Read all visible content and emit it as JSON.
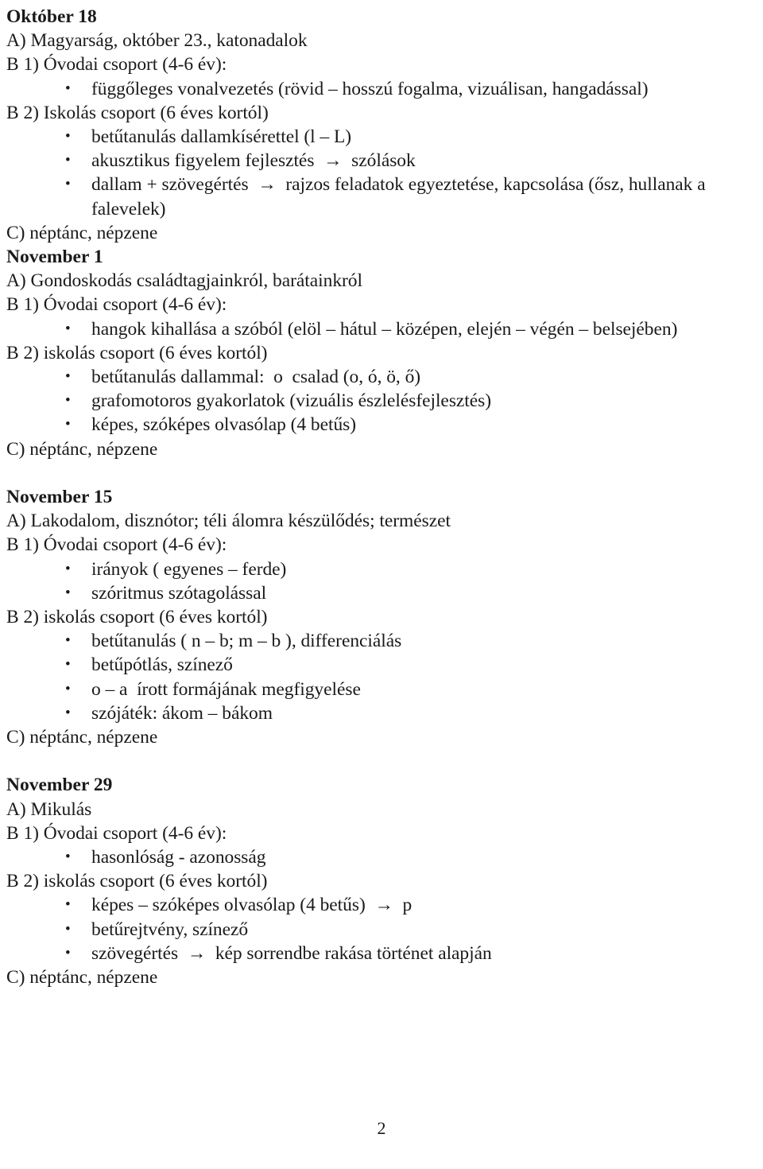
{
  "document": {
    "page_number": "2",
    "bullet_glyph": "•",
    "text_color": "#1a1a1a",
    "background_color": "#ffffff",
    "sections": [
      {
        "date": "Október 18",
        "gap_before": false,
        "lines": [
          {
            "type": "plain",
            "text": "A) Magyarság, október 23., katonadalok"
          },
          {
            "type": "plain",
            "text": "B 1) Óvodai csoport (4-6 év):"
          },
          {
            "type": "bullet",
            "text": "függőleges vonalvezetés (rövid – hosszú fogalma, vizuálisan, hangadással)"
          },
          {
            "type": "plain",
            "text": "B 2) Iskolás csoport (6 éves kortól)"
          },
          {
            "type": "bullet",
            "text": "betűtanulás dallamkísérettel (l – L)"
          },
          {
            "type": "bullet",
            "text": "akusztikus figyelem fejlesztés  →  szólások"
          },
          {
            "type": "bullet",
            "text": "dallam + szövegértés  →  rajzos feladatok egyeztetése, kapcsolása (ősz, hullanak a falevelek)"
          },
          {
            "type": "plain",
            "text": "C) néptánc, népzene"
          }
        ]
      },
      {
        "date": "November 1",
        "gap_before": false,
        "lines": [
          {
            "type": "plain",
            "text": "A) Gondoskodás családtagjainkról, barátainkról"
          },
          {
            "type": "plain",
            "text": "B 1) Óvodai csoport (4-6 év):"
          },
          {
            "type": "bullet",
            "text": "hangok kihallása a szóból (elöl – hátul – középen, elején – végén – belsejében)"
          },
          {
            "type": "plain",
            "text": "B 2) iskolás csoport (6 éves kortól)"
          },
          {
            "type": "bullet",
            "text": "betűtanulás dallammal:  o  csalad (o, ó, ö, ő)"
          },
          {
            "type": "bullet",
            "text": "grafomotoros gyakorlatok (vizuális észlelésfejlesztés)"
          },
          {
            "type": "bullet",
            "text": "képes, szóképes olvasólap (4 betűs)"
          },
          {
            "type": "plain",
            "text": "C) néptánc, népzene"
          }
        ]
      },
      {
        "date": "November 15",
        "gap_before": true,
        "lines": [
          {
            "type": "plain",
            "text": "A) Lakodalom, disznótor; téli álomra készülődés; természet"
          },
          {
            "type": "plain",
            "text": "B 1) Óvodai csoport (4-6 év):"
          },
          {
            "type": "bullet",
            "text": "irányok ( egyenes – ferde)"
          },
          {
            "type": "bullet",
            "text": "szóritmus szótagolással"
          },
          {
            "type": "plain",
            "text": "B 2) iskolás csoport (6 éves kortól)"
          },
          {
            "type": "bullet",
            "text": "betűtanulás ( n – b; m – b ), differenciálás"
          },
          {
            "type": "bullet",
            "text": "betűpótlás, színező"
          },
          {
            "type": "bullet",
            "text": "o – a  írott formájának megfigyelése"
          },
          {
            "type": "bullet",
            "text": "szójáték: ákom – bákom"
          },
          {
            "type": "plain",
            "text": "C) néptánc, népzene"
          }
        ]
      },
      {
        "date": "November 29",
        "gap_before": true,
        "lines": [
          {
            "type": "plain",
            "text": "A) Mikulás"
          },
          {
            "type": "plain",
            "text": "B 1) Óvodai csoport (4-6 év):"
          },
          {
            "type": "bullet",
            "text": "hasonlóság - azonosság"
          },
          {
            "type": "plain",
            "text": "B 2) iskolás csoport (6 éves kortól)"
          },
          {
            "type": "bullet",
            "text": "képes – szóképes olvasólap (4 betűs)  →  p"
          },
          {
            "type": "bullet",
            "text": "betűrejtvény, színező"
          },
          {
            "type": "bullet",
            "text": "szövegértés  →  kép sorrendbe rakása történet alapján"
          },
          {
            "type": "plain",
            "text": "C) néptánc, népzene"
          }
        ]
      }
    ]
  }
}
